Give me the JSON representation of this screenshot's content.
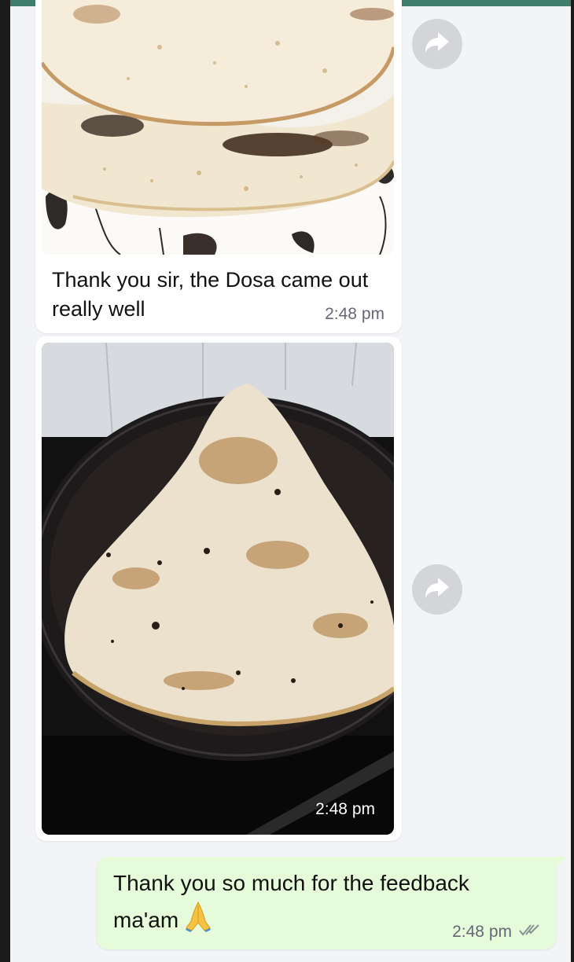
{
  "colors": {
    "header_green": "#3f7f6b",
    "chat_background": "#f3f4f7",
    "incoming_bubble": "#ffffff",
    "outgoing_bubble": "#e6fbd9",
    "forward_button": "#d3d5d9",
    "read_ticks": "#8a9096"
  },
  "messages": [
    {
      "direction": "incoming",
      "type": "image-with-caption",
      "image_subject": "stacked cooked dosas on a leaf-patterned plate",
      "caption": "Thank you sir, the Dosa came out really well",
      "time": "2:48 pm",
      "forward_icon": "forward-arrow-icon"
    },
    {
      "direction": "incoming",
      "type": "image",
      "image_subject": "cone-shaped dosa on a black tawa",
      "time": "2:48 pm",
      "forward_icon": "forward-arrow-icon"
    },
    {
      "direction": "outgoing",
      "type": "text",
      "text": "Thank you so much for the feedback ma'am",
      "emoji": "folded-hands-emoji",
      "time": "2:48 pm",
      "status_icon": "double-tick-icon"
    }
  ]
}
